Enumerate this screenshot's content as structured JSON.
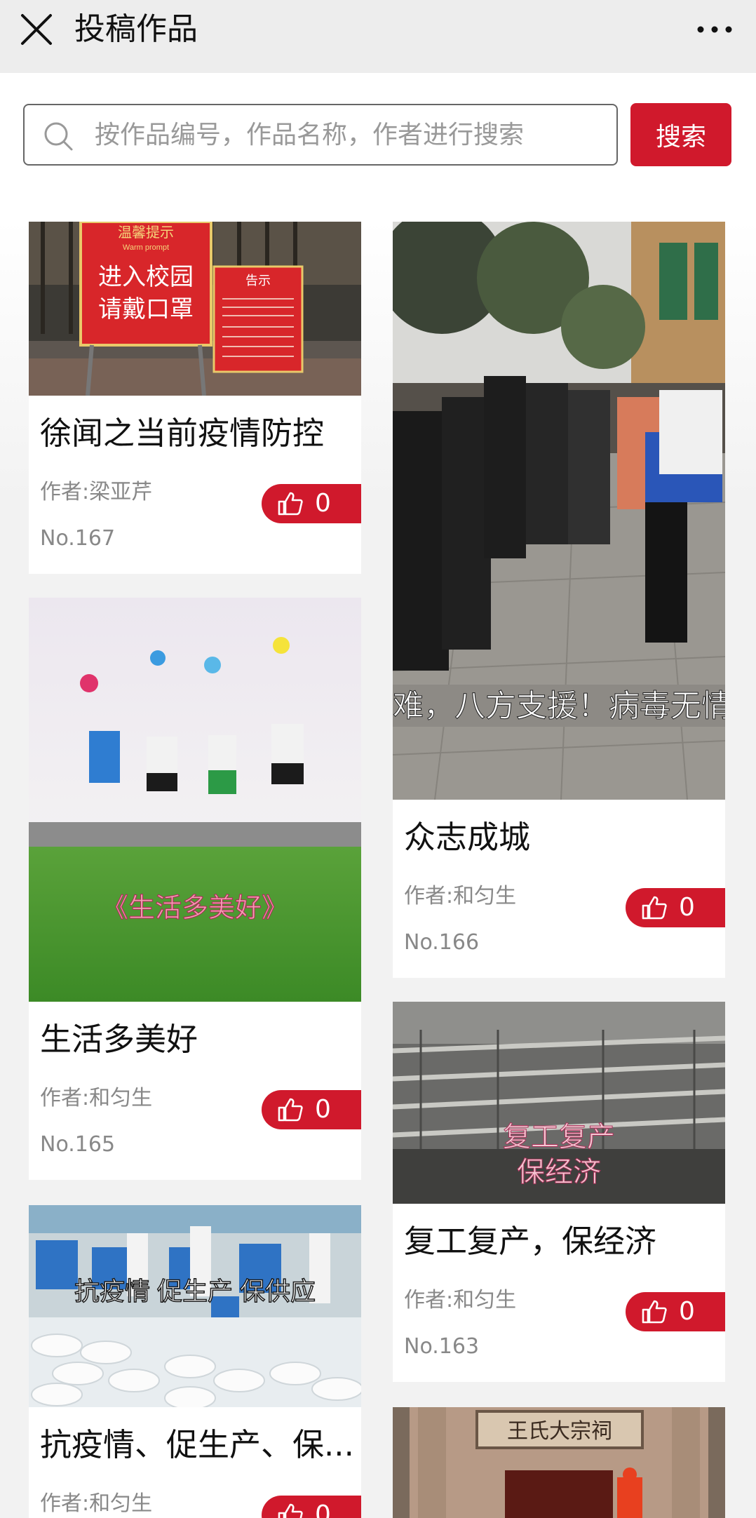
{
  "header": {
    "title": "投稿作品"
  },
  "search": {
    "placeholder": "按作品编号，作品名称，作者进行搜索",
    "button_label": "搜索"
  },
  "works": [
    {
      "title": "徐闻之当前疫情防控",
      "author": "作者:梁亚芹",
      "number": "No.167",
      "likes": "0",
      "image_text": {
        "sign_title": "温馨提示",
        "sign_sub": "Warm prompt",
        "sign_line1": "进入校园",
        "sign_line2": "请戴口罩",
        "notice_title": "告示"
      }
    },
    {
      "title": "众志成城",
      "author": "作者:和匀生",
      "number": "No.166",
      "likes": "0",
      "image_text": {
        "caption": "难，八方支援！病毒无情"
      }
    },
    {
      "title": "生活多美好",
      "author": "作者:和匀生",
      "number": "No.165",
      "likes": "0",
      "image_text": {
        "caption": "《生活多美好》"
      }
    },
    {
      "title": "复工复产，保经济",
      "author": "作者:和匀生",
      "number": "No.163",
      "likes": "0",
      "image_text": {
        "caption_line1": "复工复产",
        "caption_line2": "保经济"
      }
    },
    {
      "title": "抗疫情、促生产、保...",
      "author": "作者:和匀生",
      "number": "",
      "likes": "0",
      "image_text": {
        "caption": "抗疫情 促生产 保供应"
      }
    },
    {
      "title": "",
      "author": "",
      "number": "",
      "likes": "",
      "image_text": {
        "plaque": "王氏大宗祠"
      }
    }
  ]
}
